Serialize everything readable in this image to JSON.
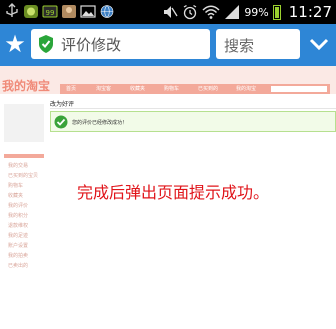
{
  "statusbar": {
    "battery_percent": "99%",
    "time": "11:27"
  },
  "toolbar": {
    "url_title": "评价修改",
    "search_label": "搜索"
  },
  "page": {
    "logo": "我的淘宝",
    "nav_items": [
      "首页",
      "淘宝客",
      "收藏夹",
      "购物车",
      "已买到的",
      "我的淘宝"
    ],
    "sidebar_items": [
      "我的交易",
      "已买到的宝贝",
      "购物车",
      "收藏夹",
      "我的评价",
      "我的积分",
      "退款维权",
      "我的足迹",
      "账户设置",
      "我的拍卖",
      "已卖出的"
    ],
    "section_title": "改为好评",
    "success_message": "您的评价已经修改成功！"
  },
  "caption": "完成后弹出页面提示成功。",
  "colors": {
    "toolbar": "#2e86d6",
    "caption": "#e0141a",
    "success_bg": "#f2fbe8",
    "success_border": "#b6e08f"
  }
}
